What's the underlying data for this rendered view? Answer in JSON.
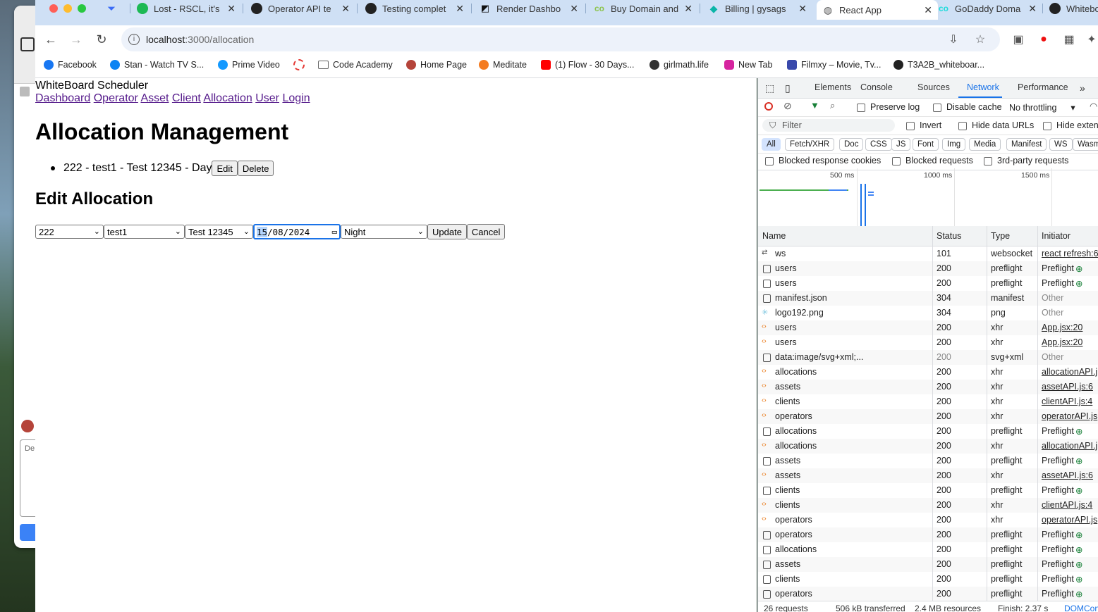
{
  "tabs": [
    {
      "title": "",
      "icon": "vpn-arrow-icon"
    },
    {
      "title": "Lost - RSCL, it's",
      "icon": "spotify-icon"
    },
    {
      "title": "Operator API te",
      "icon": "github-icon"
    },
    {
      "title": "Testing complet",
      "icon": "github-icon"
    },
    {
      "title": "Render Dashbo",
      "icon": "render-icon"
    },
    {
      "title": "Buy Domain and",
      "icon": "godaddy-icon"
    },
    {
      "title": "Billing | gysags",
      "icon": "diamond-icon"
    },
    {
      "title": "React App",
      "icon": "globe-icon",
      "active": true
    },
    {
      "title": "GoDaddy Doma",
      "icon": "godaddy-icon"
    },
    {
      "title": "Whitebo",
      "icon": "github-icon"
    }
  ],
  "address": {
    "host": "localhost",
    "path": ":3000/allocation"
  },
  "bookmarks": [
    {
      "label": "Facebook",
      "color": "#1877f2"
    },
    {
      "label": "Stan - Watch TV S...",
      "color": "#0b84f3"
    },
    {
      "label": "Prime Video",
      "color": "#1399ff"
    },
    {
      "label": "",
      "color": "#e53935"
    },
    {
      "label": "Code Academy",
      "color": "#888888"
    },
    {
      "label": "Home Page",
      "color": "#b5443a"
    },
    {
      "label": "Meditate",
      "color": "#f47b20"
    },
    {
      "label": "(1) Flow - 30 Days...",
      "color": "#ff0000"
    },
    {
      "label": "girlmath.life",
      "color": "#333333"
    },
    {
      "label": "New Tab",
      "color": "#d6249f"
    },
    {
      "label": "Filmxy – Movie, Tv...",
      "color": "#3949ab"
    },
    {
      "label": "T3A2B_whiteboar...",
      "color": "#222222"
    }
  ],
  "page": {
    "app_title": "WhiteBoard Scheduler",
    "nav": [
      "Dashboard",
      "Operator",
      "Asset",
      "Client",
      "Allocation",
      "User",
      "Login"
    ],
    "heading": "Allocation Management",
    "allocations": [
      {
        "text": "222 - test1 - Test 12345 - Day",
        "edit": "Edit",
        "delete": "Delete"
      }
    ],
    "edit_heading": "Edit Allocation",
    "form": {
      "operator": "222",
      "asset": "test1",
      "client": "Test 12345",
      "date_day": "15",
      "date_rest": "/08/2024",
      "shift": "Night",
      "update": "Update",
      "cancel": "Cancel"
    }
  },
  "devtools": {
    "tabs": [
      "Elements",
      "Console",
      "Sources",
      "Network",
      "Performance"
    ],
    "active_tab": "Network",
    "toolbar": {
      "preserve_log": "Preserve log",
      "disable_cache": "Disable cache",
      "throttling": "No throttling"
    },
    "filter": {
      "placeholder": "Filter",
      "invert": "Invert",
      "hide_data_urls": "Hide data URLs",
      "hide_ext": "Hide exten"
    },
    "type_filters": [
      "All",
      "Fetch/XHR",
      "Doc",
      "CSS",
      "JS",
      "Font",
      "Img",
      "Media",
      "Manifest",
      "WS",
      "Wasm"
    ],
    "blocked": {
      "cookies": "Blocked response cookies",
      "requests": "Blocked requests",
      "third_party": "3rd-party requests"
    },
    "timeline_ticks": [
      "500 ms",
      "1000 ms",
      "1500 ms"
    ],
    "columns": [
      "Name",
      "Status",
      "Type",
      "Initiator"
    ],
    "requests": [
      {
        "name": "ws",
        "status": "101",
        "type": "websocket",
        "initiator": "react refresh:6",
        "kind": "ws",
        "link": true
      },
      {
        "name": "users",
        "status": "200",
        "type": "preflight",
        "initiator": "Preflight",
        "kind": "doc",
        "link": false
      },
      {
        "name": "users",
        "status": "200",
        "type": "preflight",
        "initiator": "Preflight",
        "kind": "doc",
        "link": false
      },
      {
        "name": "manifest.json",
        "status": "304",
        "type": "manifest",
        "initiator": "Other",
        "kind": "doc",
        "link": false,
        "muted": true
      },
      {
        "name": "logo192.png",
        "status": "304",
        "type": "png",
        "initiator": "Other",
        "kind": "png",
        "link": false,
        "muted": true
      },
      {
        "name": "users",
        "status": "200",
        "type": "xhr",
        "initiator": "App.jsx:20",
        "kind": "xhr",
        "link": true
      },
      {
        "name": "users",
        "status": "200",
        "type": "xhr",
        "initiator": "App.jsx:20",
        "kind": "xhr",
        "link": true
      },
      {
        "name": "data:image/svg+xml;...",
        "status": "200",
        "type": "svg+xml",
        "initiator": "Other",
        "kind": "doc",
        "link": false,
        "muted": true,
        "status_muted": true
      },
      {
        "name": "allocations",
        "status": "200",
        "type": "xhr",
        "initiator": "allocationAPI.j",
        "kind": "xhr",
        "link": true
      },
      {
        "name": "assets",
        "status": "200",
        "type": "xhr",
        "initiator": "assetAPI.js:6",
        "kind": "xhr",
        "link": true
      },
      {
        "name": "clients",
        "status": "200",
        "type": "xhr",
        "initiator": "clientAPI.js:4",
        "kind": "xhr",
        "link": true
      },
      {
        "name": "operators",
        "status": "200",
        "type": "xhr",
        "initiator": "operatorAPI.js",
        "kind": "xhr",
        "link": true
      },
      {
        "name": "allocations",
        "status": "200",
        "type": "preflight",
        "initiator": "Preflight",
        "kind": "doc",
        "link": false
      },
      {
        "name": "allocations",
        "status": "200",
        "type": "xhr",
        "initiator": "allocationAPI.j",
        "kind": "xhr",
        "link": true
      },
      {
        "name": "assets",
        "status": "200",
        "type": "preflight",
        "initiator": "Preflight",
        "kind": "doc",
        "link": false
      },
      {
        "name": "assets",
        "status": "200",
        "type": "xhr",
        "initiator": "assetAPI.js:6",
        "kind": "xhr",
        "link": true
      },
      {
        "name": "clients",
        "status": "200",
        "type": "preflight",
        "initiator": "Preflight",
        "kind": "doc",
        "link": false
      },
      {
        "name": "clients",
        "status": "200",
        "type": "xhr",
        "initiator": "clientAPI.js:4",
        "kind": "xhr",
        "link": true
      },
      {
        "name": "operators",
        "status": "200",
        "type": "xhr",
        "initiator": "operatorAPI.js",
        "kind": "xhr",
        "link": true
      },
      {
        "name": "operators",
        "status": "200",
        "type": "preflight",
        "initiator": "Preflight",
        "kind": "doc",
        "link": false
      },
      {
        "name": "allocations",
        "status": "200",
        "type": "preflight",
        "initiator": "Preflight",
        "kind": "doc",
        "link": false
      },
      {
        "name": "assets",
        "status": "200",
        "type": "preflight",
        "initiator": "Preflight",
        "kind": "doc",
        "link": false
      },
      {
        "name": "clients",
        "status": "200",
        "type": "preflight",
        "initiator": "Preflight",
        "kind": "doc",
        "link": false
      },
      {
        "name": "operators",
        "status": "200",
        "type": "preflight",
        "initiator": "Preflight",
        "kind": "doc",
        "link": false
      }
    ],
    "status_bar": {
      "requests": "26 requests",
      "transferred": "506 kB transferred",
      "resources": "2.4 MB resources",
      "finish": "Finish: 2.37 s",
      "dom": "DOMCon"
    }
  },
  "back_window": {
    "placeholder": "De"
  }
}
